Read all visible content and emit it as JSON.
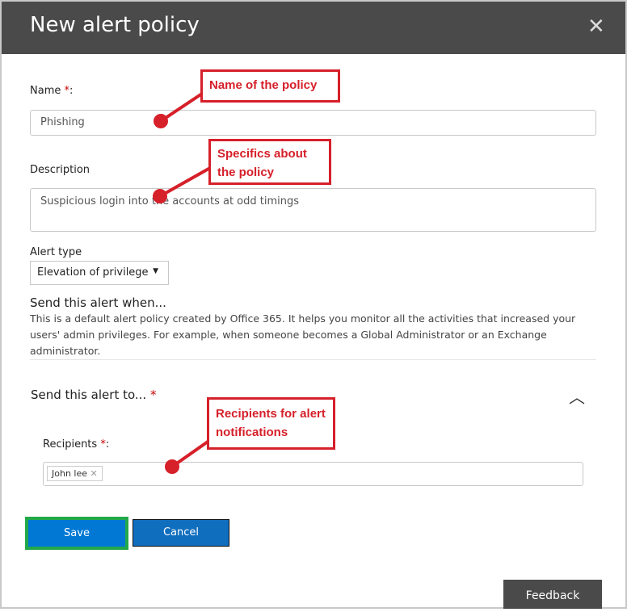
{
  "header": {
    "title": "New alert policy",
    "close_icon": "close-icon"
  },
  "form": {
    "name_label": "Name",
    "required_mark": "*",
    "name_value": "Phishing",
    "description_label": "Description",
    "description_value": "Suspicious login into the accounts at odd timings",
    "alert_type_label": "Alert type",
    "alert_type_value": "Elevation of privilege",
    "send_when_heading": "Send this alert when...",
    "send_when_text": "This is a default alert policy created by Office 365. It helps you monitor all the activities that increased your users' admin privileges. For example, when someone becomes a Global Administrator or an Exchange administrator.",
    "send_to_heading": "Send this alert to...",
    "recipients_label": "Recipients",
    "recipients": [
      "John lee"
    ]
  },
  "buttons": {
    "save": "Save",
    "cancel": "Cancel",
    "feedback": "Feedback"
  },
  "annotations": {
    "name": "Name of the policy",
    "description": "Specifics about the policy",
    "recipients": "Recipients for alert notifications"
  },
  "colors": {
    "header": "#4a4a4a",
    "primary": "#0078d4",
    "annotation": "#d6202a",
    "highlight": "#22a84a"
  }
}
